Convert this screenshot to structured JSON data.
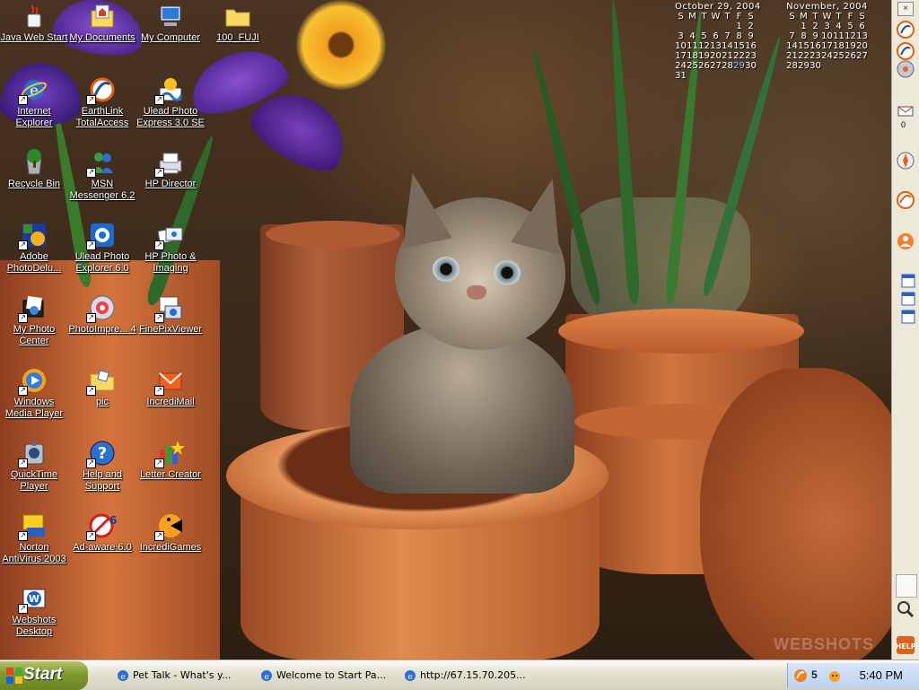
{
  "desktop": {
    "icons": [
      {
        "label": "Java Web Start",
        "icon": "java-icon"
      },
      {
        "label": "My Documents",
        "icon": "my-documents-icon"
      },
      {
        "label": "My Computer",
        "icon": "my-computer-icon"
      },
      {
        "label": "100_FUJI",
        "icon": "folder-icon"
      },
      {
        "label": "Internet Explorer",
        "icon": "internet-explorer-icon"
      },
      {
        "label": "EarthLink TotalAccess",
        "icon": "earthlink-icon"
      },
      {
        "label": "Ulead Photo Express 3.0 SE",
        "icon": "ulead-photo-express-icon"
      },
      {
        "label": "Recycle Bin",
        "icon": "recycle-bin-icon"
      },
      {
        "label": "MSN Messenger 6.2",
        "icon": "msn-messenger-icon"
      },
      {
        "label": "HP Director",
        "icon": "hp-director-icon"
      },
      {
        "label": "Adobe PhotoDelu...",
        "icon": "adobe-photodeluxe-icon"
      },
      {
        "label": "Ulead Photo Explorer 6.0",
        "icon": "ulead-photo-explorer-icon"
      },
      {
        "label": "HP Photo & Imaging",
        "icon": "hp-photo-imaging-icon"
      },
      {
        "label": "My Photo Center",
        "icon": "my-photo-center-icon"
      },
      {
        "label": "PhotoImpre... 4",
        "icon": "photoimpression-icon"
      },
      {
        "label": "FinePixViewer",
        "icon": "finepixviewer-icon"
      },
      {
        "label": "Windows Media Player",
        "icon": "windows-media-player-icon"
      },
      {
        "label": "pic",
        "icon": "pic-folder-icon"
      },
      {
        "label": "IncrediMail",
        "icon": "incredimail-icon"
      },
      {
        "label": "QuickTime Player",
        "icon": "quicktime-icon"
      },
      {
        "label": "Help and Support",
        "icon": "help-icon"
      },
      {
        "label": "Letter Creator",
        "icon": "letter-creator-icon"
      },
      {
        "label": "Norton AntiVirus 2003",
        "icon": "norton-antivirus-icon"
      },
      {
        "label": "Ad-aware 6.0",
        "icon": "ad-aware-icon"
      },
      {
        "label": "IncrediGames",
        "icon": "incredigames-icon"
      },
      {
        "label": "Webshots Desktop",
        "icon": "webshots-icon"
      }
    ]
  },
  "calendars": [
    {
      "title": "October 29, 2004",
      "days": [
        "S",
        "M",
        "T",
        "W",
        "T",
        "F",
        "S"
      ],
      "dates": [
        "",
        "",
        "",
        "",
        "",
        "1",
        "2",
        "3",
        "4",
        "5",
        "6",
        "7",
        "8",
        "9",
        "10",
        "11",
        "12",
        "13",
        "14",
        "15",
        "16",
        "17",
        "18",
        "19",
        "20",
        "21",
        "22",
        "23",
        "24",
        "25",
        "26",
        "27",
        "28",
        "29",
        "30",
        "31"
      ],
      "today": "29"
    },
    {
      "title": "November, 2004",
      "days": [
        "S",
        "M",
        "T",
        "W",
        "T",
        "F",
        "S"
      ],
      "dates": [
        "",
        "1",
        "2",
        "3",
        "4",
        "5",
        "6",
        "7",
        "8",
        "9",
        "10",
        "11",
        "12",
        "13",
        "14",
        "15",
        "16",
        "17",
        "18",
        "19",
        "20",
        "21",
        "22",
        "23",
        "24",
        "25",
        "26",
        "27",
        "28",
        "29",
        "30"
      ],
      "today": ""
    }
  ],
  "watermark": "WEBSHOTS",
  "sidebar": {
    "buttons": [
      "earthlink-icon",
      "earthlink-icon",
      "disc-icon",
      "mail-icon",
      "compass-icon",
      "earthlink-search-icon",
      "user-icon",
      "window-icon",
      "window-icon",
      "window-icon",
      "magnifier-icon",
      "help-icon"
    ],
    "mail_count": "0",
    "help_label": "HELP"
  },
  "taskbar": {
    "start_label": "Start",
    "tasks": [
      {
        "title": "Pet Talk - What's y...",
        "icon": "ie-icon"
      },
      {
        "title": "Welcome to Start Pa...",
        "icon": "ie-icon"
      },
      {
        "title": "http://67.15.70.205...",
        "icon": "ie-icon"
      }
    ],
    "tray": {
      "clock": "5:40 PM",
      "badge": "5"
    }
  },
  "colors": {
    "taskbar_start": "#7e9a2c",
    "tray": "#bcd2f0",
    "calendar_today": "#9cc8ff"
  }
}
